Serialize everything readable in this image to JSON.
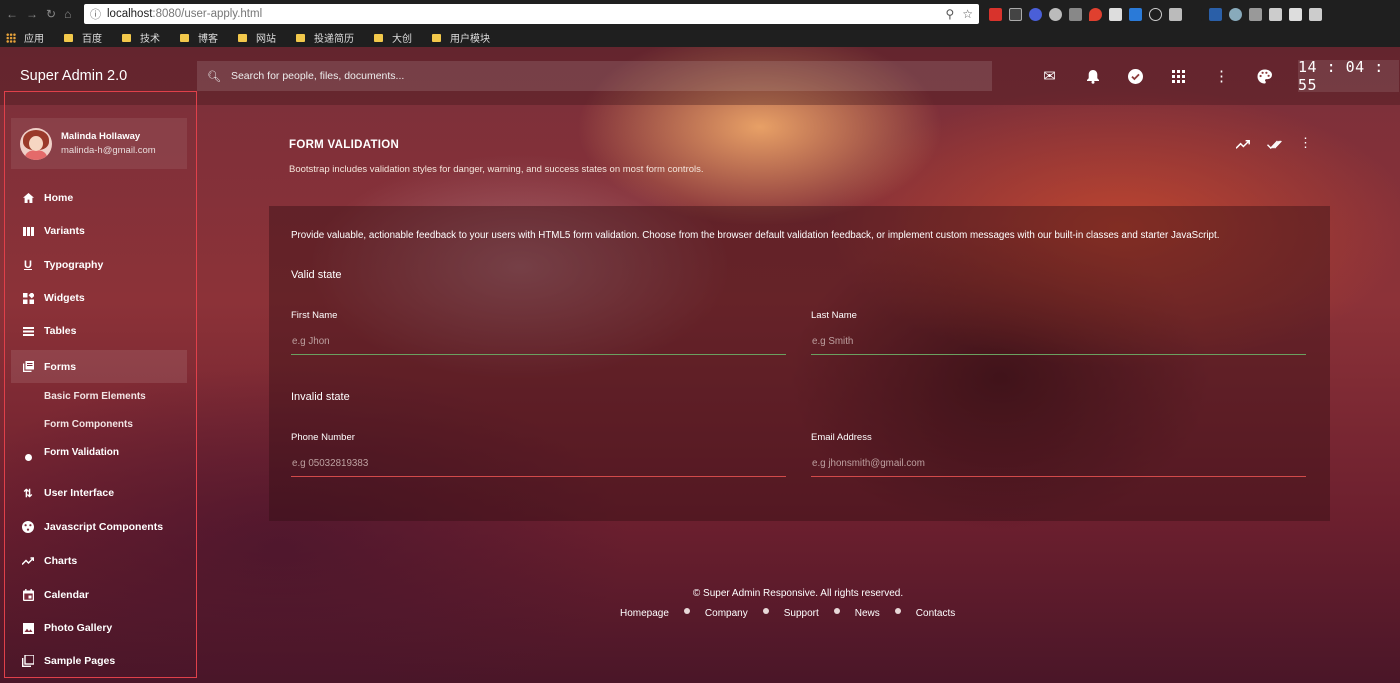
{
  "browser": {
    "url_host": "localhost",
    "url_path": ":8080/user-apply.html",
    "bookmarks": [
      "应用",
      "百度",
      "技术",
      "博客",
      "网站",
      "投递简历",
      "大创",
      "用户模块"
    ]
  },
  "topbar": {
    "brand": "Super Admin 2.0",
    "search_placeholder": "Search for people, files, documents...",
    "clock": "14 : 04 : 55"
  },
  "profile": {
    "name": "Malinda Hollaway",
    "email": "malinda-h@gmail.com"
  },
  "sidebar": {
    "items": [
      {
        "label": "Home",
        "icon": "home-icon"
      },
      {
        "label": "Variants",
        "icon": "columns-icon"
      },
      {
        "label": "Typography",
        "icon": "underline-icon"
      },
      {
        "label": "Widgets",
        "icon": "widgets-icon"
      },
      {
        "label": "Tables",
        "icon": "table-icon"
      },
      {
        "label": "Forms",
        "icon": "forms-icon"
      },
      {
        "label": "User Interface",
        "icon": "swap-icon"
      },
      {
        "label": "Javascript Components",
        "icon": "components-icon"
      },
      {
        "label": "Charts",
        "icon": "trending-icon"
      },
      {
        "label": "Calendar",
        "icon": "calendar-icon"
      },
      {
        "label": "Photo Gallery",
        "icon": "image-icon"
      },
      {
        "label": "Sample Pages",
        "icon": "pages-icon"
      }
    ],
    "forms_sub": [
      "Basic Form Elements",
      "Form Components",
      "Form Validation"
    ]
  },
  "main": {
    "title": "FORM VALIDATION",
    "subtitle": "Bootstrap includes validation styles for danger, warning, and success states on most form controls.",
    "card": {
      "description": "Provide valuable, actionable feedback to your users with HTML5 form validation. Choose from the browser default validation feedback, or implement custom messages with our built-in classes and starter JavaScript.",
      "valid_heading": "Valid state",
      "invalid_heading": "Invalid state",
      "fields": {
        "first_name": {
          "label": "First Name",
          "placeholder": "e.g Jhon"
        },
        "last_name": {
          "label": "Last Name",
          "placeholder": "e.g Smith"
        },
        "phone": {
          "label": "Phone Number",
          "placeholder": "e.g 05032819383"
        },
        "email": {
          "label": "Email Address",
          "placeholder": "e.g jhonsmith@gmail.com"
        }
      }
    }
  },
  "footer": {
    "copyright": "© Super Admin Responsive. All rights reserved.",
    "links": [
      "Homepage",
      "Company",
      "Support",
      "News",
      "Contacts"
    ]
  },
  "colors": {
    "valid": "#6aa060",
    "invalid": "#d24a4a",
    "sidebar_outline": "#e0404a"
  }
}
